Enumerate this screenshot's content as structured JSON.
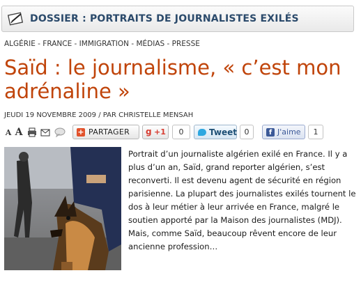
{
  "banner": {
    "title": "DOSSIER : PORTRAITS DE JOURNALISTES EXILÉS",
    "icon": "pencil-paper-icon"
  },
  "tags": "ALGÉRIE - FRANCE - IMMIGRATION - MÉDIAS - PRESSE",
  "article": {
    "title": "Saïd : le journalisme, « c’est mon adrénaline »",
    "byline": "JEUDI 19 NOVEMBRE 2009 / PAR CHRISTELLE MENSAH",
    "lead": "Portrait d’un journaliste algérien exilé en France. Il y a plus d’un an, Saïd, grand reporter algérien, s’est reconverti. Il est devenu agent de sécurité en région parisienne. La plupart des journalistes exilés tournent le dos à leur métier à leur arrivée en France, malgré le soutien apporté par la Maison des journalistes (MDJ). Mais, comme Saïd, beaucoup rêvent encore de leur ancienne profession…"
  },
  "tools": {
    "font_smaller": "A",
    "font_larger": "A",
    "share_label": "PARTAGER",
    "gplus_label": "+1",
    "gplus_count": "0",
    "tweet_label": "Tweet",
    "tweet_count": "0",
    "like_label": "J'aime",
    "like_count": "1"
  },
  "colors": {
    "title": "#c0440a",
    "banner_text": "#2b4a6b",
    "twitter": "#2ea7e0",
    "facebook": "#3b5998",
    "google": "#d73d32"
  }
}
